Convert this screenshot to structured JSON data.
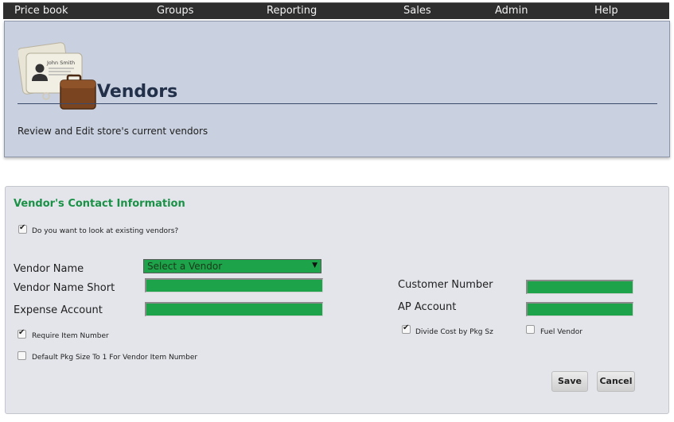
{
  "nav": {
    "items": [
      "Price book",
      "Groups",
      "Reporting",
      "Sales",
      "Admin",
      "Help"
    ]
  },
  "header": {
    "title": "Vendors",
    "subtitle": "Review and Edit store's current vendors",
    "icon_card_text": "John Smith",
    "icon": "vendor-cards-briefcase-icon"
  },
  "contact": {
    "title": "Vendor's Contact Information",
    "existing_vendors": {
      "label": "Do you want to look at existing vendors?",
      "checked": true
    },
    "vendor_name": {
      "label": "Vendor Name",
      "selected": "Select a Vendor"
    },
    "vendor_name_short": {
      "label": "Vendor Name Short",
      "value": ""
    },
    "expense_account": {
      "label": "Expense Account",
      "value": ""
    },
    "customer_number": {
      "label": "Customer Number",
      "value": ""
    },
    "ap_account": {
      "label": "AP Account",
      "value": ""
    },
    "require_item_number": {
      "label": "Require Item Number",
      "checked": true
    },
    "default_pkg_size": {
      "label": "Default Pkg Size To 1 For Vendor Item Number",
      "checked": false
    },
    "divide_cost": {
      "label": "Divide Cost by Pkg Sz",
      "checked": true
    },
    "fuel_vendor": {
      "label": "Fuel Vendor",
      "checked": false
    },
    "save_label": "Save",
    "cancel_label": "Cancel"
  },
  "colors": {
    "accent_green": "#1da34a",
    "title_green": "#1a9147",
    "nav_bg": "#2e2e2e",
    "header_bg": "#c9d0df"
  }
}
